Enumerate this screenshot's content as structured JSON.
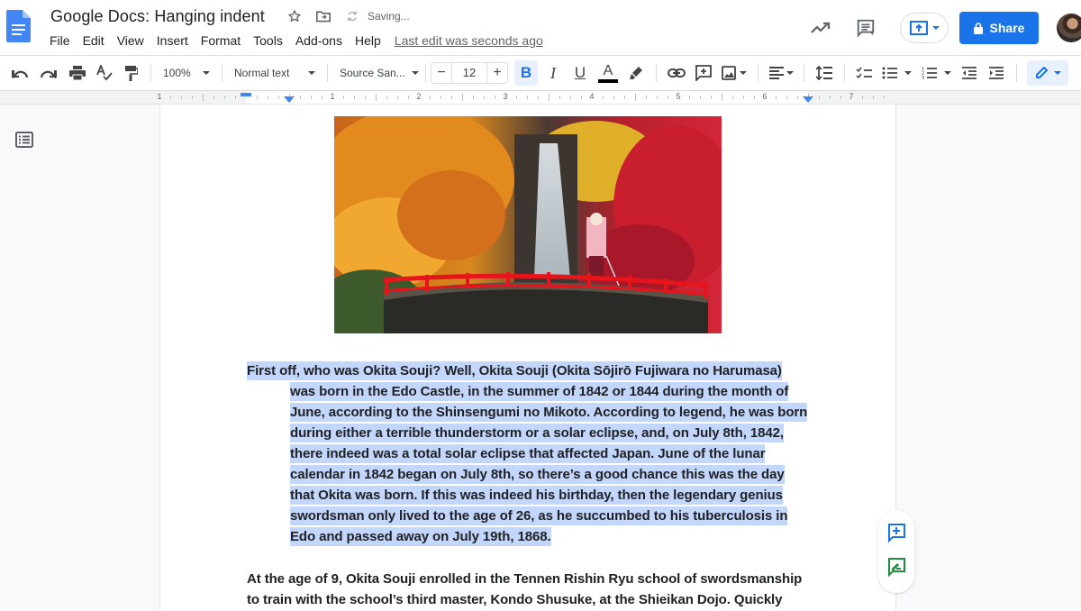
{
  "header": {
    "title": "Google Docs: Hanging indent",
    "status": "Saving...",
    "last_edit": "Last edit was seconds ago",
    "share_label": "Share",
    "icons": [
      "docs-logo-icon",
      "star-icon",
      "move-to-folder-icon",
      "sync-icon",
      "activity-trend-icon",
      "comments-icon",
      "present-icon",
      "lock-icon",
      "account-avatar"
    ]
  },
  "menu": [
    "File",
    "Edit",
    "View",
    "Insert",
    "Format",
    "Tools",
    "Add-ons",
    "Help"
  ],
  "toolbar": {
    "zoom": "100%",
    "style": "Normal text",
    "font": "Source San...",
    "font_size": "12",
    "minus_label": "−",
    "plus_label": "+",
    "bold_label": "B",
    "italic_label": "I",
    "underline_label": "U",
    "text_color_label": "A",
    "text_color": "#000000",
    "accent": "#1a73e8",
    "active_bg": "#e8f0fe"
  },
  "ruler": {
    "labels": [
      "1",
      "1",
      "2",
      "3",
      "4",
      "5",
      "6",
      "7"
    ]
  },
  "document": {
    "image_alt": "Autumn waterfall with red bridge and figure",
    "paragraph1": [
      "First off, who was Okita Souji? Well, Okita Souji (Okita Sōjirō Fujiwara no Harumasa)",
      "was born in the Edo Castle, in the summer of 1842 or 1844 during the month of",
      "June, according to the Shinsengumi no Mikoto. According to legend, he was born",
      "during either a terrible thunderstorm or a solar eclipse, and, on July 8th, 1842,",
      "there indeed was a total solar eclipse that affected Japan. June of the lunar",
      "calendar in 1842 began on July 8th, so there’s a good chance this was the day",
      "that Okita was born. If this was indeed his birthday, then the legendary genius",
      "swordsman only lived to the age of 26, as he succumbed to his tuberculosis in",
      "Edo and passed away on July 19th, 1868."
    ],
    "paragraph2": [
      "At the age of 9, Okita Souji enrolled in the Tennen Rishin Ryu school of swordsmanship",
      "to train with the school’s third master, Kondo Shusuke, at the Shieikan Dojo. Quickly"
    ],
    "selection_color": "#c2d7fb"
  }
}
